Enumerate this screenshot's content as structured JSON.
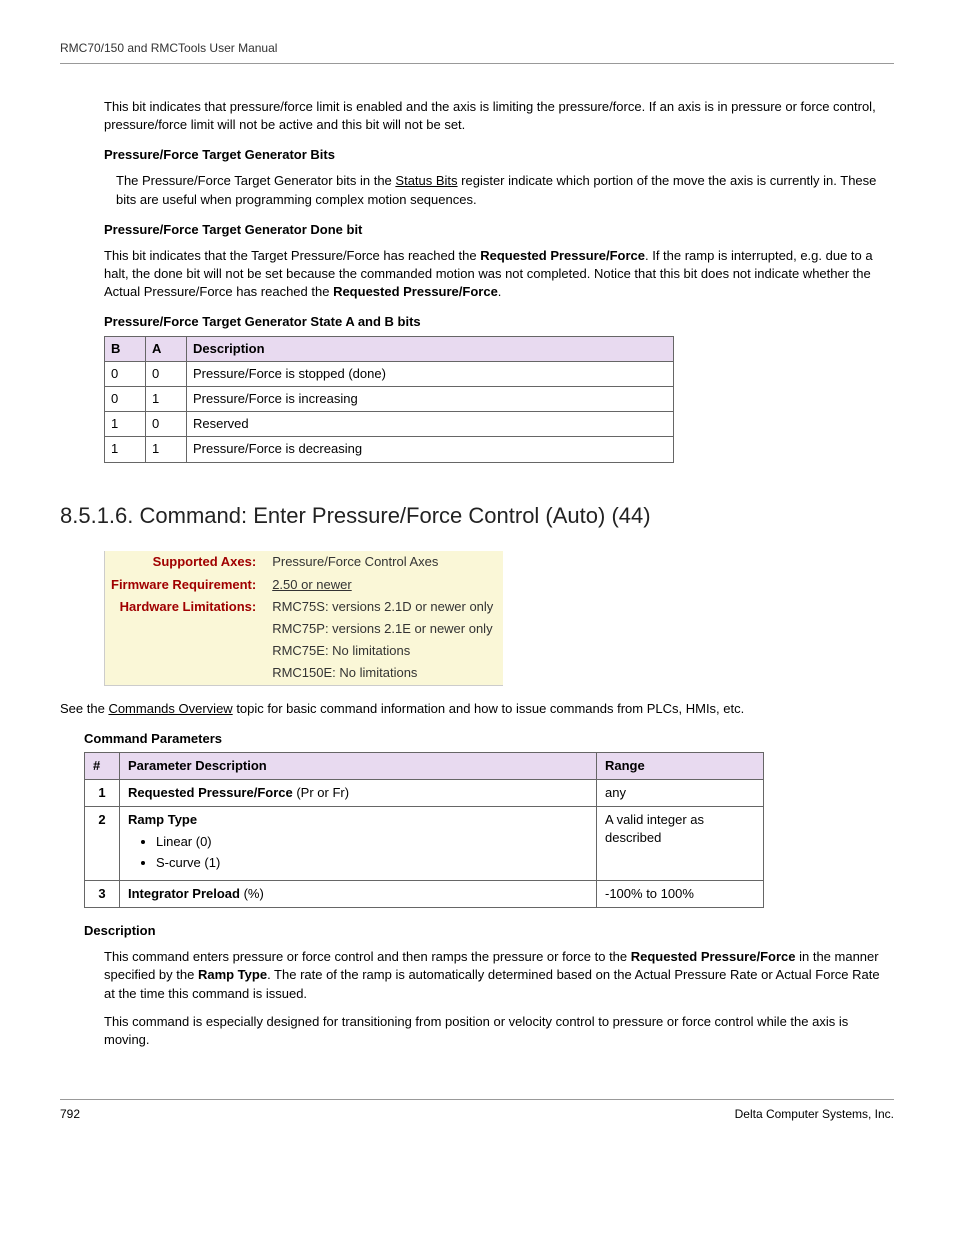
{
  "header": {
    "left": "RMC70/150 and RMCTools User Manual"
  },
  "intro_para": "This bit indicates that pressure/force limit is enabled and the axis is limiting the pressure/force. If an axis is in pressure or force control, pressure/force limit will not be active and this bit will not be set.",
  "h1": "Pressure/Force Target Generator Bits",
  "p1a": "The Pressure/Force Target Generator bits in the ",
  "p1_link": "Status Bits",
  "p1b": " register indicate which portion of the move the axis is currently in. These bits are useful when programming complex motion sequences.",
  "h2": "Pressure/Force Target Generator Done bit",
  "p2a": "This bit indicates that the Target Pressure/Force has reached the ",
  "p2_bold1": "Requested Pressure/Force",
  "p2b": ". If the ramp is interrupted, e.g. due to a halt, the done bit will not be set because the commanded motion was not completed. Notice that this bit does not indicate whether the Actual Pressure/Force has reached the ",
  "p2_bold2": "Requested Pressure/Force",
  "p2c": ".",
  "h3": "Pressure/Force Target Generator State A and B bits",
  "state_table": {
    "headers": [
      "B",
      "A",
      "Description"
    ],
    "rows": [
      [
        "0",
        "0",
        "Pressure/Force is stopped (done)"
      ],
      [
        "0",
        "1",
        "Pressure/Force is increasing"
      ],
      [
        "1",
        "0",
        "Reserved"
      ],
      [
        "1",
        "1",
        "Pressure/Force is decreasing"
      ]
    ]
  },
  "section_title": "8.5.1.6. Command: Enter Pressure/Force Control (Auto) (44)",
  "infobox": {
    "rows": [
      {
        "label": "Supported Axes:",
        "value": "Pressure/Force Control Axes",
        "link": false
      },
      {
        "label": "Firmware Requirement:",
        "value": "2.50 or newer",
        "link": true
      },
      {
        "label": "Hardware Limitations:",
        "value": "RMC75S: versions 2.1D or newer only",
        "link": false
      }
    ],
    "extra": [
      "RMC75P: versions 2.1E or newer only",
      "RMC75E: No limitations",
      "RMC150E: No limitations"
    ]
  },
  "see_a": "See the ",
  "see_link": "Commands Overview",
  "see_b": " topic for basic command information and how to issue commands from PLCs, HMIs, etc.",
  "cmd_params_heading": "Command Parameters",
  "params_table": {
    "headers": [
      "#",
      "Parameter Description",
      "Range"
    ],
    "rows": [
      {
        "n": "1",
        "desc_bold": "Requested Pressure/Force",
        "desc_rest": " (Pr or Fr)",
        "range": "any",
        "bullets": []
      },
      {
        "n": "2",
        "desc_bold": "Ramp Type",
        "desc_rest": "",
        "range": "A valid integer as described",
        "bullets": [
          "Linear (0)",
          "S-curve (1)"
        ]
      },
      {
        "n": "3",
        "desc_bold": "Integrator Preload",
        "desc_rest": " (%)",
        "range": "-100% to 100%",
        "bullets": []
      }
    ]
  },
  "desc_heading": "Description",
  "desc_p1a": "This command enters pressure or force control and then ramps the pressure or force to the ",
  "desc_p1_b1": "Requested Pressure/Force",
  "desc_p1b": " in the manner specified by the ",
  "desc_p1_b2": "Ramp Type",
  "desc_p1c": ". The rate of the ramp is automatically determined based on the Actual Pressure Rate or Actual Force Rate at the time this command is issued.",
  "desc_p2": "This command is especially designed for transitioning from position or velocity control to pressure or force control while the axis is moving.",
  "footer": {
    "left": "792",
    "right": "Delta Computer Systems, Inc."
  }
}
